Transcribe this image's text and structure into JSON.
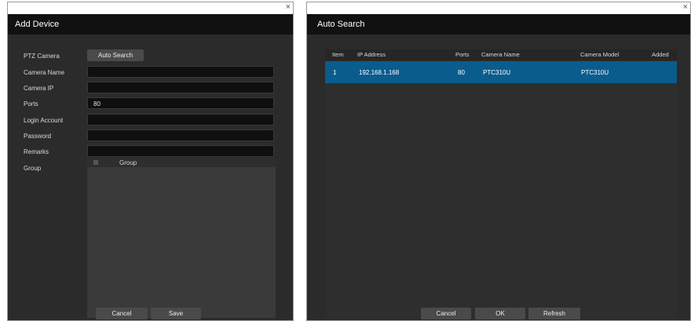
{
  "add_device": {
    "title": "Add Device",
    "close": "×",
    "fields": {
      "ptz_camera_label": "PTZ Camera",
      "auto_search_label": "Auto Search",
      "camera_name_label": "Camera Name",
      "camera_name_value": "",
      "camera_ip_label": "Camera IP",
      "camera_ip_value": "",
      "ports_label": "Ports",
      "ports_value": "80",
      "login_account_label": "Login Account",
      "login_account_value": "",
      "password_label": "Password",
      "password_value": "",
      "remarks_label": "Remarks",
      "remarks_value": "",
      "group_label": "Group",
      "group_column": "Group"
    },
    "cancel_label": "Cancel",
    "save_label": "Save"
  },
  "auto_search": {
    "title": "Auto Search",
    "close": "×",
    "columns": {
      "item": "Item",
      "ip": "IP Address",
      "ports": "Ports",
      "name": "Camera Name",
      "model": "Camera Model",
      "added": "Added"
    },
    "rows": [
      {
        "item": "1",
        "ip": "192.168.1.168",
        "ports": "80",
        "name": "PTC310U",
        "model": "PTC310U",
        "added": ""
      }
    ],
    "cancel_label": "Cancel",
    "ok_label": "OK",
    "refresh_label": "Refresh"
  },
  "colors": {
    "dialog_bg": "#2b2b2b",
    "titlebar_bg": "#111111",
    "selected_row": "#0a5c8d",
    "button_bg": "#4a4a4a"
  }
}
